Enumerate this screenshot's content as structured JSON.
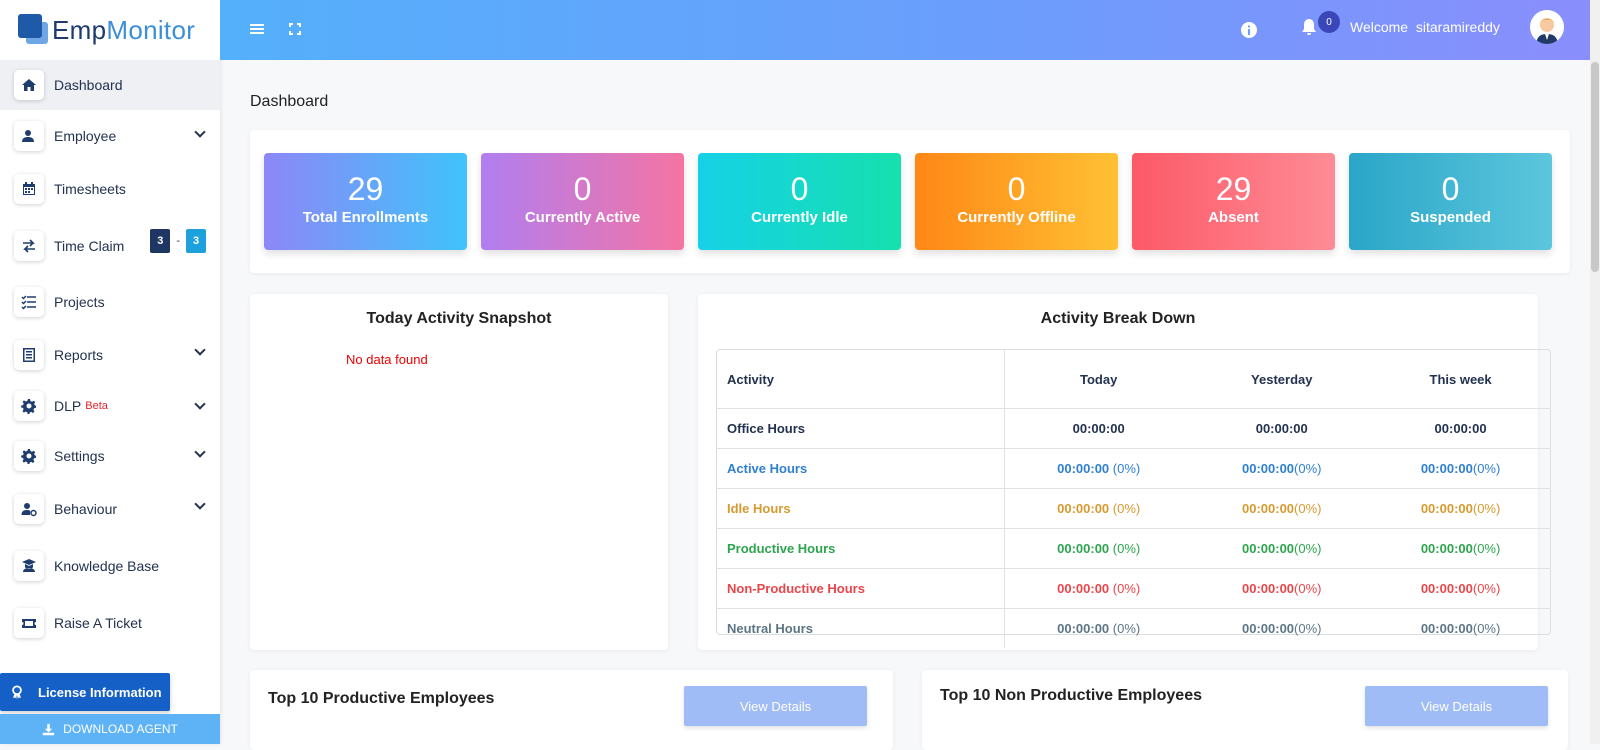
{
  "brand": {
    "part1": "Emp",
    "part2": "Monitor"
  },
  "sidebar": {
    "items": [
      {
        "label": "Dashboard",
        "icon": "home-icon"
      },
      {
        "label": "Employee",
        "icon": "employee-icon"
      },
      {
        "label": "Timesheets",
        "icon": "calendar-icon"
      },
      {
        "label": "Time Claim",
        "icon": "swap-icon",
        "badge_left": "3",
        "separator": "-",
        "badge_right": "3"
      },
      {
        "label": "Projects",
        "icon": "checklist-icon"
      },
      {
        "label": "Reports",
        "icon": "report-icon"
      },
      {
        "label": "DLP",
        "icon": "gear-icon",
        "tag": "Beta"
      },
      {
        "label": "Settings",
        "icon": "gear-icon"
      },
      {
        "label": "Behaviour",
        "icon": "user-gear-icon"
      },
      {
        "label": "Knowledge Base",
        "icon": "graduate-icon"
      },
      {
        "label": "Raise A Ticket",
        "icon": "ticket-icon"
      }
    ],
    "license_label": "License Information",
    "download_label": "DOWNLOAD AGENT"
  },
  "header": {
    "notification_count": "0",
    "welcome_prefix": "Welcome",
    "username": "sitaramireddy"
  },
  "page": {
    "title": "Dashboard"
  },
  "stats": [
    {
      "value": "29",
      "label": "Total Enrollments"
    },
    {
      "value": "0",
      "label": "Currently Active"
    },
    {
      "value": "0",
      "label": "Currently Idle"
    },
    {
      "value": "0",
      "label": "Currently Offline"
    },
    {
      "value": "29",
      "label": "Absent"
    },
    {
      "value": "0",
      "label": "Suspended"
    }
  ],
  "snapshot": {
    "title": "Today Activity Snapshot",
    "empty_text": "No data found"
  },
  "breakdown": {
    "title": "Activity Break Down",
    "columns": [
      "Activity",
      "Today",
      "Yesterday",
      "This week"
    ],
    "rows": [
      {
        "label": "Office Hours",
        "today": "00:00:00",
        "today_pct": "",
        "yesterday": "00:00:00",
        "yesterday_pct": "",
        "week": "00:00:00",
        "week_pct": ""
      },
      {
        "label": "Active Hours",
        "today": "00:00:00",
        "today_pct": " (0%)",
        "yesterday": "00:00:00",
        "yesterday_pct": "(0%)",
        "week": "00:00:00",
        "week_pct": "(0%)"
      },
      {
        "label": "Idle Hours",
        "today": "00:00:00",
        "today_pct": " (0%)",
        "yesterday": "00:00:00",
        "yesterday_pct": "(0%)",
        "week": "00:00:00",
        "week_pct": "(0%)"
      },
      {
        "label": "Productive Hours",
        "today": "00:00:00",
        "today_pct": " (0%)",
        "yesterday": "00:00:00",
        "yesterday_pct": "(0%)",
        "week": "00:00:00",
        "week_pct": "(0%)"
      },
      {
        "label": "Non-Productive Hours",
        "today": "00:00:00",
        "today_pct": " (0%)",
        "yesterday": "00:00:00",
        "yesterday_pct": "(0%)",
        "week": "00:00:00",
        "week_pct": "(0%)"
      },
      {
        "label": "Neutral Hours",
        "today": "00:00:00",
        "today_pct": " (0%)",
        "yesterday": "00:00:00",
        "yesterday_pct": "(0%)",
        "week": "00:00:00",
        "week_pct": "(0%)"
      }
    ]
  },
  "top_productive": {
    "title": "Top 10 Productive Employees",
    "button": "View Details"
  },
  "top_nonproductive": {
    "title": "Top 10 Non Productive Employees",
    "button": "View Details"
  }
}
